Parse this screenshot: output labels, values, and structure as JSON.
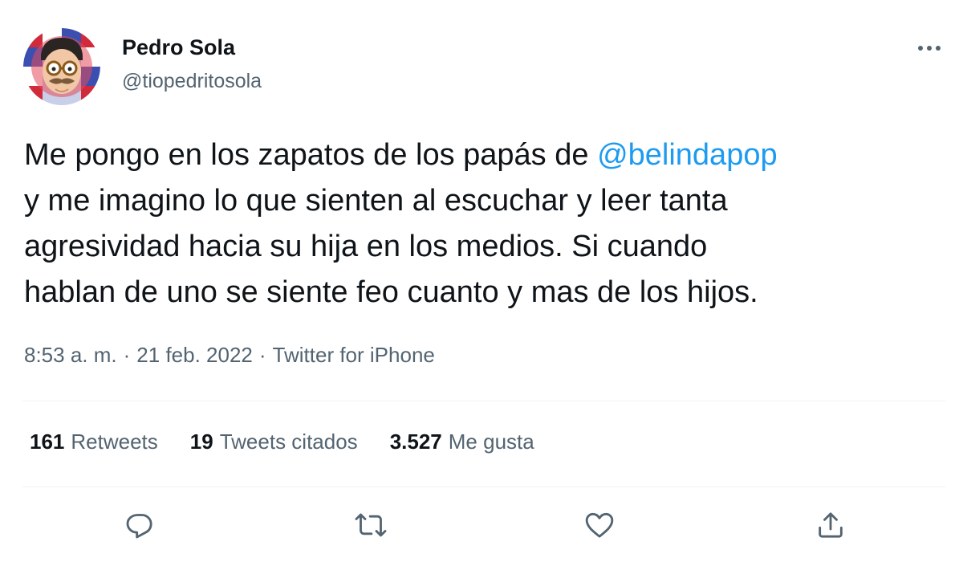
{
  "author": {
    "name": "Pedro Sola",
    "handle": "@tiopedritosola"
  },
  "tweet": {
    "line1_text": "Me pongo en los zapatos de los papás de ",
    "mention": "@belindapop",
    "line2": "y me imagino lo que sienten al escuchar y leer tanta",
    "line3": "agresividad hacia su hija en los medios. Si cuando",
    "line4": "hablan de uno se siente feo cuanto y mas de los hijos."
  },
  "meta": {
    "time": "8:53 a. m.",
    "separator": "·",
    "date": "21 feb. 2022",
    "source": "Twitter for iPhone"
  },
  "stats": {
    "retweets_count": "161",
    "retweets_label": "Retweets",
    "quotes_count": "19",
    "quotes_label": "Tweets citados",
    "likes_count": "3.527",
    "likes_label": "Me gusta"
  },
  "icons": {
    "more": "more-horizontal-icon",
    "reply": "reply-icon",
    "retweet": "retweet-icon",
    "like": "heart-icon",
    "share": "share-icon"
  },
  "colors": {
    "text": "#0f1419",
    "secondary": "#536471",
    "link": "#1d9bf0",
    "divider": "#eff3f4"
  }
}
